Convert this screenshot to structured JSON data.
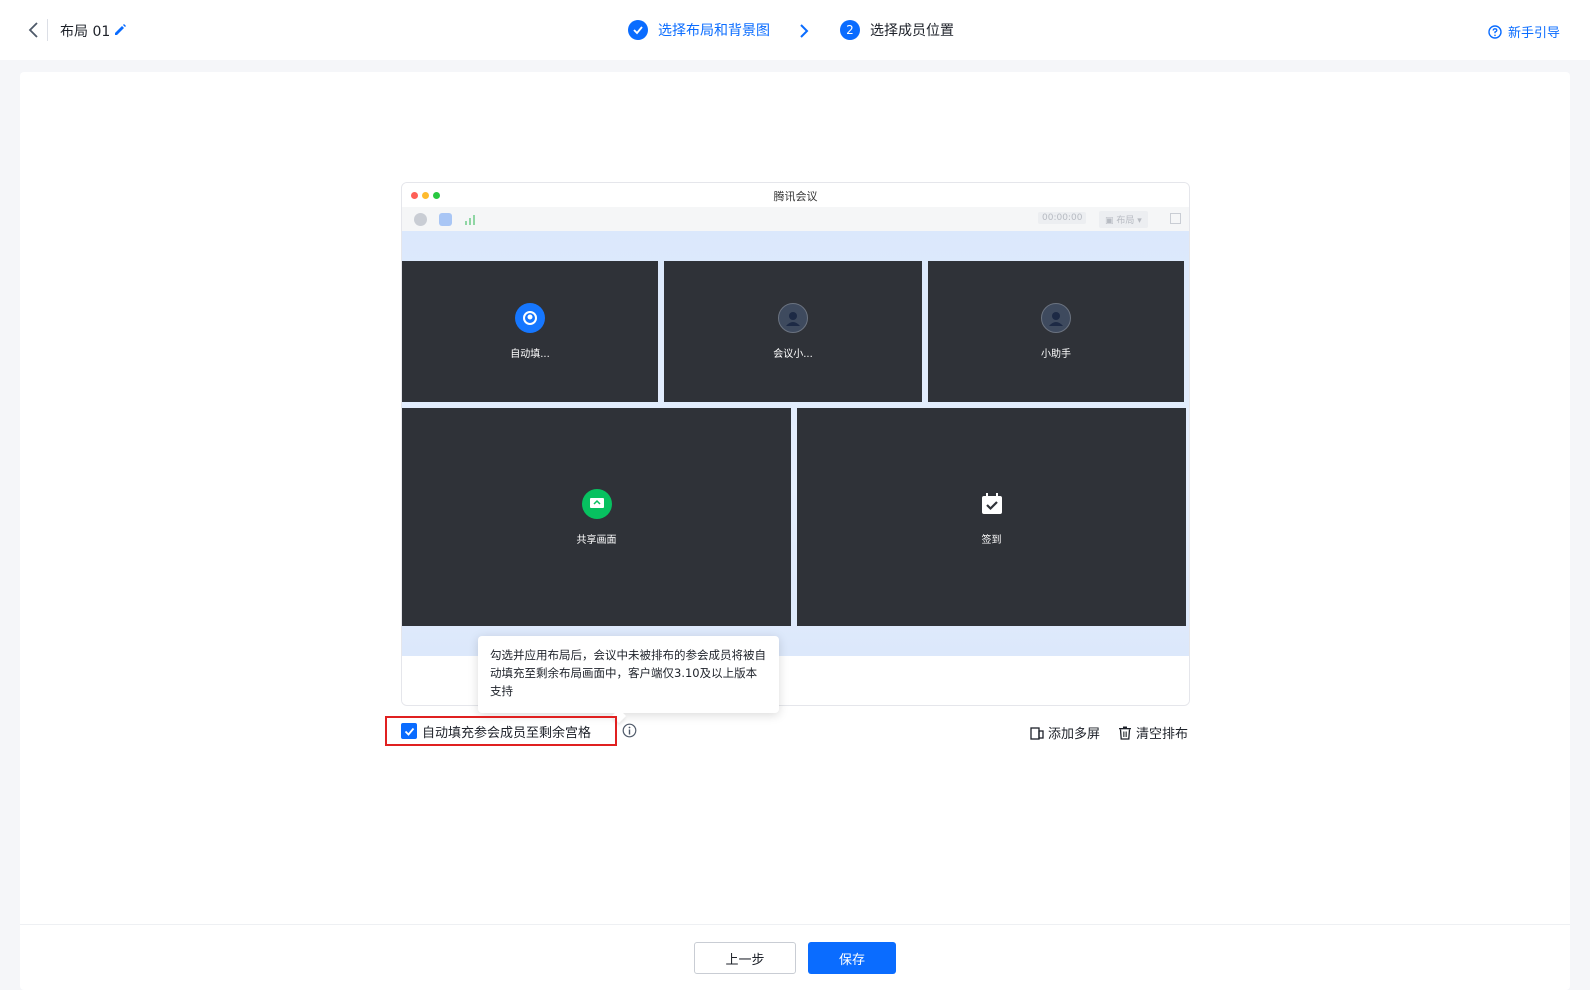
{
  "header": {
    "layout_name": "布局 01",
    "steps": [
      {
        "label": "选择布局和背景图",
        "status": "done"
      },
      {
        "number": "2",
        "label": "选择成员位置",
        "status": "current"
      }
    ],
    "guide_label": "新手引导"
  },
  "preview": {
    "window_title": "腾讯会议",
    "timer": "00:00:00",
    "layout_dropdown": "布局",
    "tiles": [
      {
        "label": "自动填...",
        "icon": "auto-fill-icon"
      },
      {
        "label": "会议小...",
        "icon": "person-icon"
      },
      {
        "label": "小助手",
        "icon": "person-icon"
      },
      {
        "label": "共享画面",
        "icon": "screen-share-icon"
      },
      {
        "label": "签到",
        "icon": "calendar-check-icon"
      }
    ]
  },
  "tooltip": {
    "text": "勾选并应用布局后，会议中未被排布的参会成员将被自动填充至剩余布局画面中，客户端仅3.10及以上版本支持"
  },
  "options": {
    "autofill_label": "自动填充参会成员至剩余宫格",
    "autofill_checked": true,
    "add_screen_label": "添加多屏",
    "clear_layout_label": "清空排布"
  },
  "footer": {
    "prev_label": "上一步",
    "save_label": "保存"
  },
  "colors": {
    "accent": "#0a6cff",
    "highlight_border": "#e02020",
    "tile_bg": "#2f3238"
  }
}
